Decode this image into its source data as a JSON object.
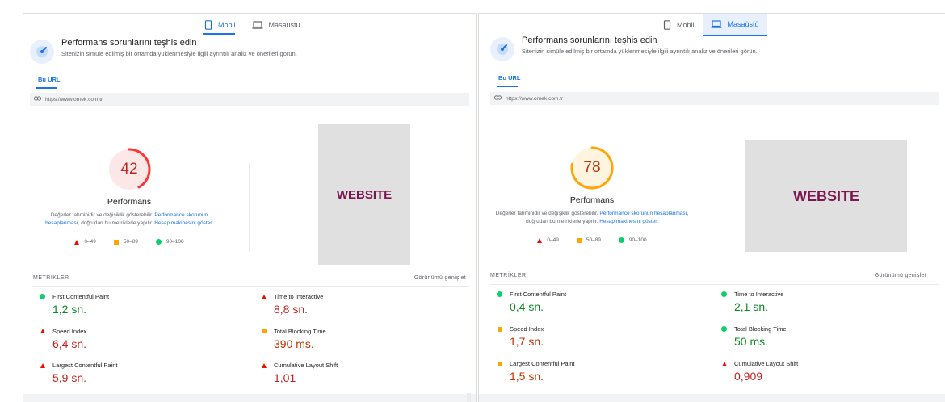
{
  "left": {
    "tabs": [
      {
        "label": "Mobil",
        "icon": "phone-icon"
      },
      {
        "label": "Masaustu",
        "icon": "laptop-icon"
      }
    ],
    "header_title": "Performans sorunlarını teşhis edin",
    "header_sub": "Sitenizin simüle edilmiş bir ortamda yüklenmesiyle ilgili ayrıntılı analiz ve önerileri görün.",
    "url_tab": "Bu URL",
    "url": "https://www.ornek.com.tr",
    "score": "42",
    "score_value": 42,
    "score_color": "#ff3333",
    "perf_label": "Performans",
    "desc_part1": "Değerler tahminidir ve değişiklik gösterebilir.",
    "desc_link1": "Performance skorunun hesaplanması",
    "desc_part2": ", doğrudan bu metriklerle yapılır.",
    "desc_link2": "Hesap makinesini göster.",
    "legend": [
      "0–49",
      "50–89",
      "90–100"
    ],
    "website": "WEBSITE",
    "metrics_label": "METRİKLER",
    "expand_label": "Görünümü genişlet",
    "metrics": [
      {
        "name": "First Contentful Paint",
        "value": "1,2 sn.",
        "status": "good"
      },
      {
        "name": "Time to Interactive",
        "value": "8,8 sn.",
        "status": "poor"
      },
      {
        "name": "Speed Index",
        "value": "6,4 sn.",
        "status": "poor"
      },
      {
        "name": "Total Blocking Time",
        "value": "390 ms.",
        "status": "average"
      },
      {
        "name": "Largest Contentful Paint",
        "value": "5,9 sn.",
        "status": "poor"
      },
      {
        "name": "Cumulative Layout Shift",
        "value": "1,01",
        "status": "poor"
      }
    ]
  },
  "right": {
    "tabs": [
      {
        "label": "Mobil",
        "icon": "phone-icon"
      },
      {
        "label": "Masaüstü",
        "icon": "laptop-icon"
      }
    ],
    "header_title": "Performans sorunlarını teşhis edin",
    "header_sub": "Sitenizin simüle edilmiş bir ortamda yüklenmesiyle ilgili ayrıntılı analiz ve önerileri görün.",
    "url_tab": "Bu URL",
    "url": "https://www.ornek.com.tr",
    "score": "78",
    "score_value": 78,
    "score_color": "#ffa400",
    "perf_label": "Performans",
    "desc_part1": "Değerler tahminidir ve değişiklik gösterebilir.",
    "desc_link1": "Performance skorunun hesaplanması",
    "desc_part2": ", doğrudan bu metriklerle yapılır.",
    "desc_link2": "Hesap makinesini göster.",
    "legend": [
      "0–49",
      "50–89",
      "90–100"
    ],
    "website": "WEBSITE",
    "metrics_label": "METRİKLER",
    "expand_label": "Görünümü genişlet",
    "metrics": [
      {
        "name": "First Contentful Paint",
        "value": "0,4 sn.",
        "status": "good"
      },
      {
        "name": "Time to Interactive",
        "value": "2,1 sn.",
        "status": "good"
      },
      {
        "name": "Speed Index",
        "value": "1,7 sn.",
        "status": "average"
      },
      {
        "name": "Total Blocking Time",
        "value": "50 ms.",
        "status": "good"
      },
      {
        "name": "Largest Contentful Paint",
        "value": "1,5 sn.",
        "status": "average"
      },
      {
        "name": "Cumulative Layout Shift",
        "value": "0,909",
        "status": "poor"
      }
    ]
  }
}
